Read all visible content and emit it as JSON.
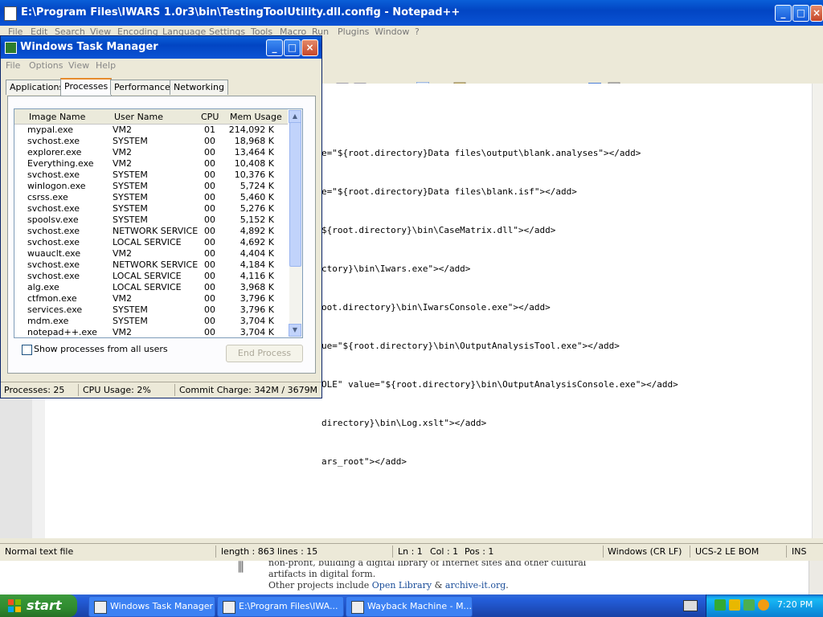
{
  "notepad": {
    "title": "E:\\Program Files\\IWARS 1.0r3\\bin\\TestingToolUtility.dll.config - Notepad++",
    "menu": [
      "File",
      "Edit",
      "Search",
      "View",
      "Encoding",
      "Language",
      "Settings",
      "Tools",
      "Macro",
      "Run",
      "Plugins",
      "Window",
      "?"
    ],
    "code_lines": [
      "e=\"${root.directory}Data files\\output\\blank.analyses\"></add>",
      "e=\"${root.directory}Data files\\blank.isf\"></add>",
      "${root.directory}\\bin\\CaseMatrix.dll\"></add>",
      "ctory}\\bin\\Iwars.exe\"></add>",
      "oot.directory}\\bin\\IwarsConsole.exe\"></add>",
      "ue=\"${root.directory}\\bin\\OutputAnalysisTool.exe\"></add>",
      "OLE\" value=\"${root.directory}\\bin\\OutputAnalysisConsole.exe\"></add>",
      "directory}\\bin\\Log.xslt\"></add>",
      "ars_root\"></add>"
    ],
    "status": {
      "type": "Normal text file",
      "length": "length : 863",
      "lines": "lines : 15",
      "ln": "Ln : 1",
      "col": "Col : 1",
      "pos": "Pos : 1",
      "eol": "Windows (CR LF)",
      "encoding": "UCS-2 LE BOM",
      "mode": "INS"
    }
  },
  "task_manager": {
    "title": "Windows Task Manager",
    "menu": [
      "File",
      "Options",
      "View",
      "Help"
    ],
    "tabs": [
      "Applications",
      "Processes",
      "Performance",
      "Networking"
    ],
    "active_tab": "Processes",
    "columns": [
      "Image Name",
      "User Name",
      "CPU",
      "Mem Usage"
    ],
    "rows": [
      [
        "mypal.exe",
        "VM2",
        "01",
        "214,092 K"
      ],
      [
        "svchost.exe",
        "SYSTEM",
        "00",
        "18,968 K"
      ],
      [
        "explorer.exe",
        "VM2",
        "00",
        "13,464 K"
      ],
      [
        "Everything.exe",
        "VM2",
        "00",
        "10,408 K"
      ],
      [
        "svchost.exe",
        "SYSTEM",
        "00",
        "10,376 K"
      ],
      [
        "winlogon.exe",
        "SYSTEM",
        "00",
        "5,724 K"
      ],
      [
        "csrss.exe",
        "SYSTEM",
        "00",
        "5,460 K"
      ],
      [
        "svchost.exe",
        "SYSTEM",
        "00",
        "5,276 K"
      ],
      [
        "spoolsv.exe",
        "SYSTEM",
        "00",
        "5,152 K"
      ],
      [
        "svchost.exe",
        "NETWORK SERVICE",
        "00",
        "4,892 K"
      ],
      [
        "svchost.exe",
        "LOCAL SERVICE",
        "00",
        "4,692 K"
      ],
      [
        "wuauclt.exe",
        "VM2",
        "00",
        "4,404 K"
      ],
      [
        "svchost.exe",
        "NETWORK SERVICE",
        "00",
        "4,184 K"
      ],
      [
        "svchost.exe",
        "LOCAL SERVICE",
        "00",
        "4,116 K"
      ],
      [
        "alg.exe",
        "LOCAL SERVICE",
        "00",
        "3,968 K"
      ],
      [
        "ctfmon.exe",
        "VM2",
        "00",
        "3,796 K"
      ],
      [
        "services.exe",
        "SYSTEM",
        "00",
        "3,796 K"
      ],
      [
        "mdm.exe",
        "SYSTEM",
        "00",
        "3,704 K"
      ],
      [
        "notepad++.exe",
        "VM2",
        "00",
        "3,704 K"
      ]
    ],
    "show_all_label": "Show processes from all users",
    "end_process_label": "End Process",
    "status": {
      "processes": "Processes: 25",
      "cpu": "CPU Usage: 2%",
      "commit": "Commit Charge: 342M / 3679M"
    }
  },
  "browser_bg": {
    "line1": "non-profit, building a digital library of Internet sites and other cultural",
    "line2": "artifacts in digital form.",
    "line3_prefix": "Other projects include ",
    "link1": "Open Library",
    "amp": " & ",
    "link2": "archive-it.org",
    "line3_suffix": "."
  },
  "taskbar": {
    "start_label": "start",
    "tasks": [
      "Windows Task Manager",
      "E:\\Program Files\\IWA...",
      "Wayback Machine - M..."
    ],
    "clock": "7:20 PM"
  }
}
